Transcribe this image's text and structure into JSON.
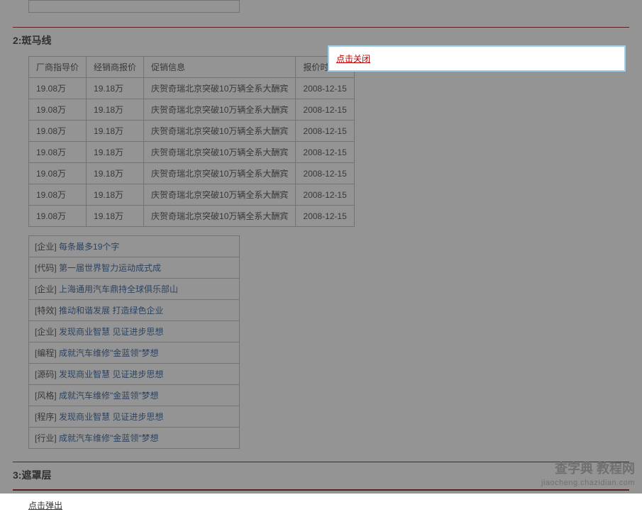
{
  "section2": {
    "title": "2:斑马线",
    "headers": [
      "厂商指导价",
      "经销商报价",
      "促销信息",
      "报价时间"
    ],
    "rows": [
      [
        "19.08万",
        "19.18万",
        "庆贺奇瑞北京突破10万辆全系大酬宾",
        "2008-12-15"
      ],
      [
        "19.08万",
        "19.18万",
        "庆贺奇瑞北京突破10万辆全系大酬宾",
        "2008-12-15"
      ],
      [
        "19.08万",
        "19.18万",
        "庆贺奇瑞北京突破10万辆全系大酬宾",
        "2008-12-15"
      ],
      [
        "19.08万",
        "19.18万",
        "庆贺奇瑞北京突破10万辆全系大酬宾",
        "2008-12-15"
      ],
      [
        "19.08万",
        "19.18万",
        "庆贺奇瑞北京突破10万辆全系大酬宾",
        "2008-12-15"
      ],
      [
        "19.08万",
        "19.18万",
        "庆贺奇瑞北京突破10万辆全系大酬宾",
        "2008-12-15"
      ],
      [
        "19.08万",
        "19.18万",
        "庆贺奇瑞北京突破10万辆全系大酬宾",
        "2008-12-15"
      ]
    ],
    "links": [
      {
        "tag": "[企业]",
        "text": "每条最多19个字"
      },
      {
        "tag": "[代码]",
        "text": "第一届世界智力运动成式成"
      },
      {
        "tag": "[企业]",
        "text": "上海通用汽车鼎持全球俱乐部山"
      },
      {
        "tag": "[特效]",
        "text": "推动和谐发展 打造绿色企业"
      },
      {
        "tag": "[企业]",
        "text": "发现商业智慧 见证进步思想"
      },
      {
        "tag": "[编程]",
        "text": "成就汽车维修\"金蓝领\"梦想"
      },
      {
        "tag": "[源码]",
        "text": "发现商业智慧 见证进步思想"
      },
      {
        "tag": "[风格]",
        "text": "成就汽车维修\"金蓝领\"梦想"
      },
      {
        "tag": "[程序]",
        "text": "发现商业智慧 见证进步思想"
      },
      {
        "tag": "[行业]",
        "text": "成就汽车维修\"金蓝领\"梦想"
      }
    ]
  },
  "section3": {
    "title": "3:遮罩层",
    "popout": "点击弹出"
  },
  "dialog": {
    "close": "点击关闭"
  },
  "watermark": {
    "line1": "查字典 教程网",
    "line2": "jiaocheng.chazidian.com"
  }
}
